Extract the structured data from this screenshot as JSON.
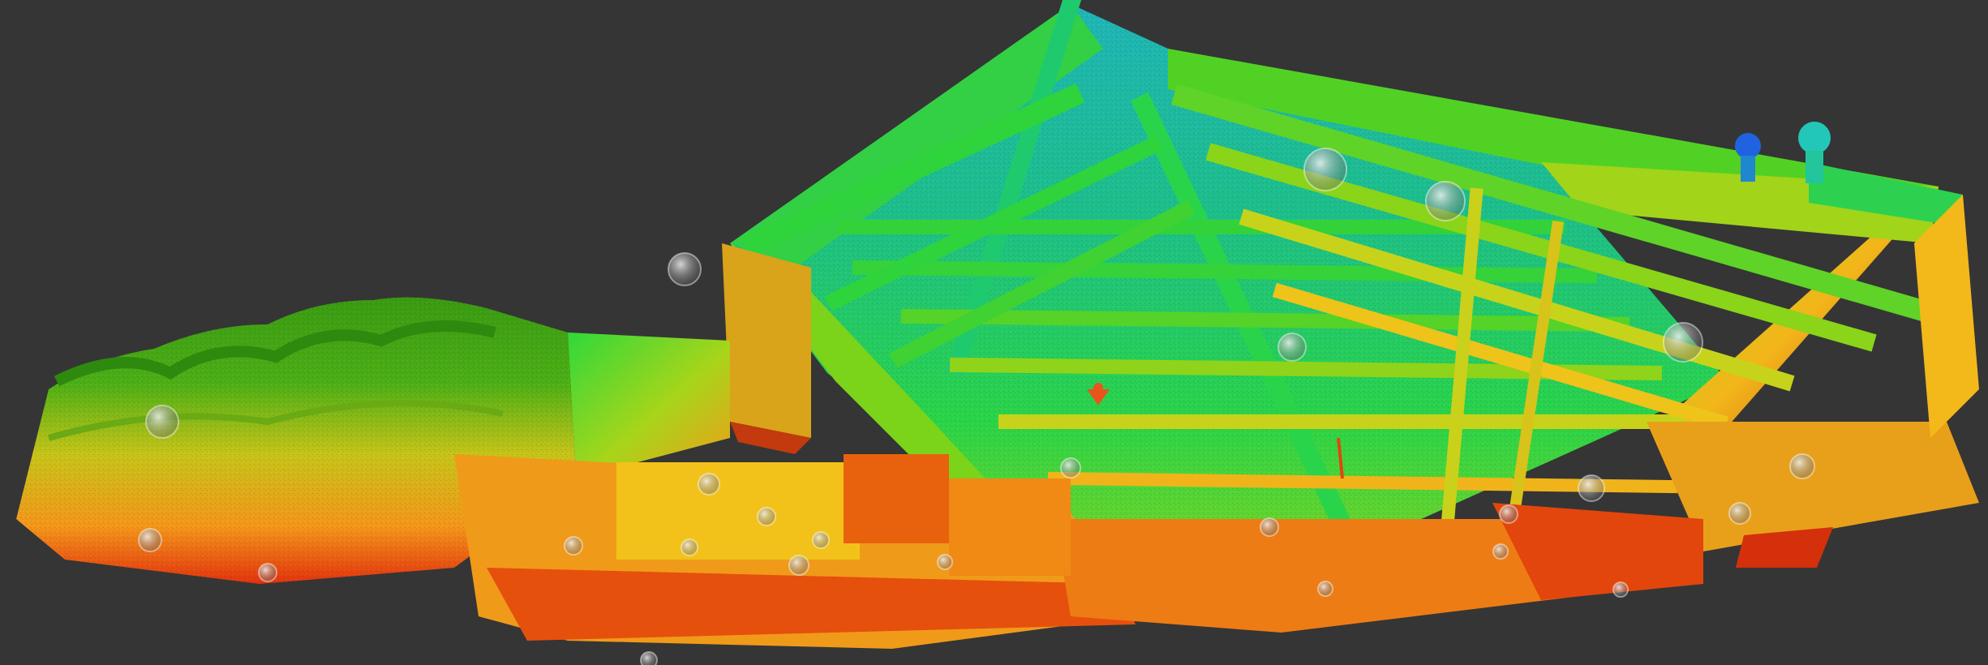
{
  "viewer": {
    "background_color": "#353535",
    "colormap": [
      "#1f5cff",
      "#19c4c8",
      "#1fd44a",
      "#6bd41a",
      "#f2e21c",
      "#f7911a",
      "#e8260c"
    ],
    "scan_marker_icon": "sphere-target-icon",
    "pin_icon": "orange-pin-icon",
    "pin_color": "#e8551a"
  }
}
